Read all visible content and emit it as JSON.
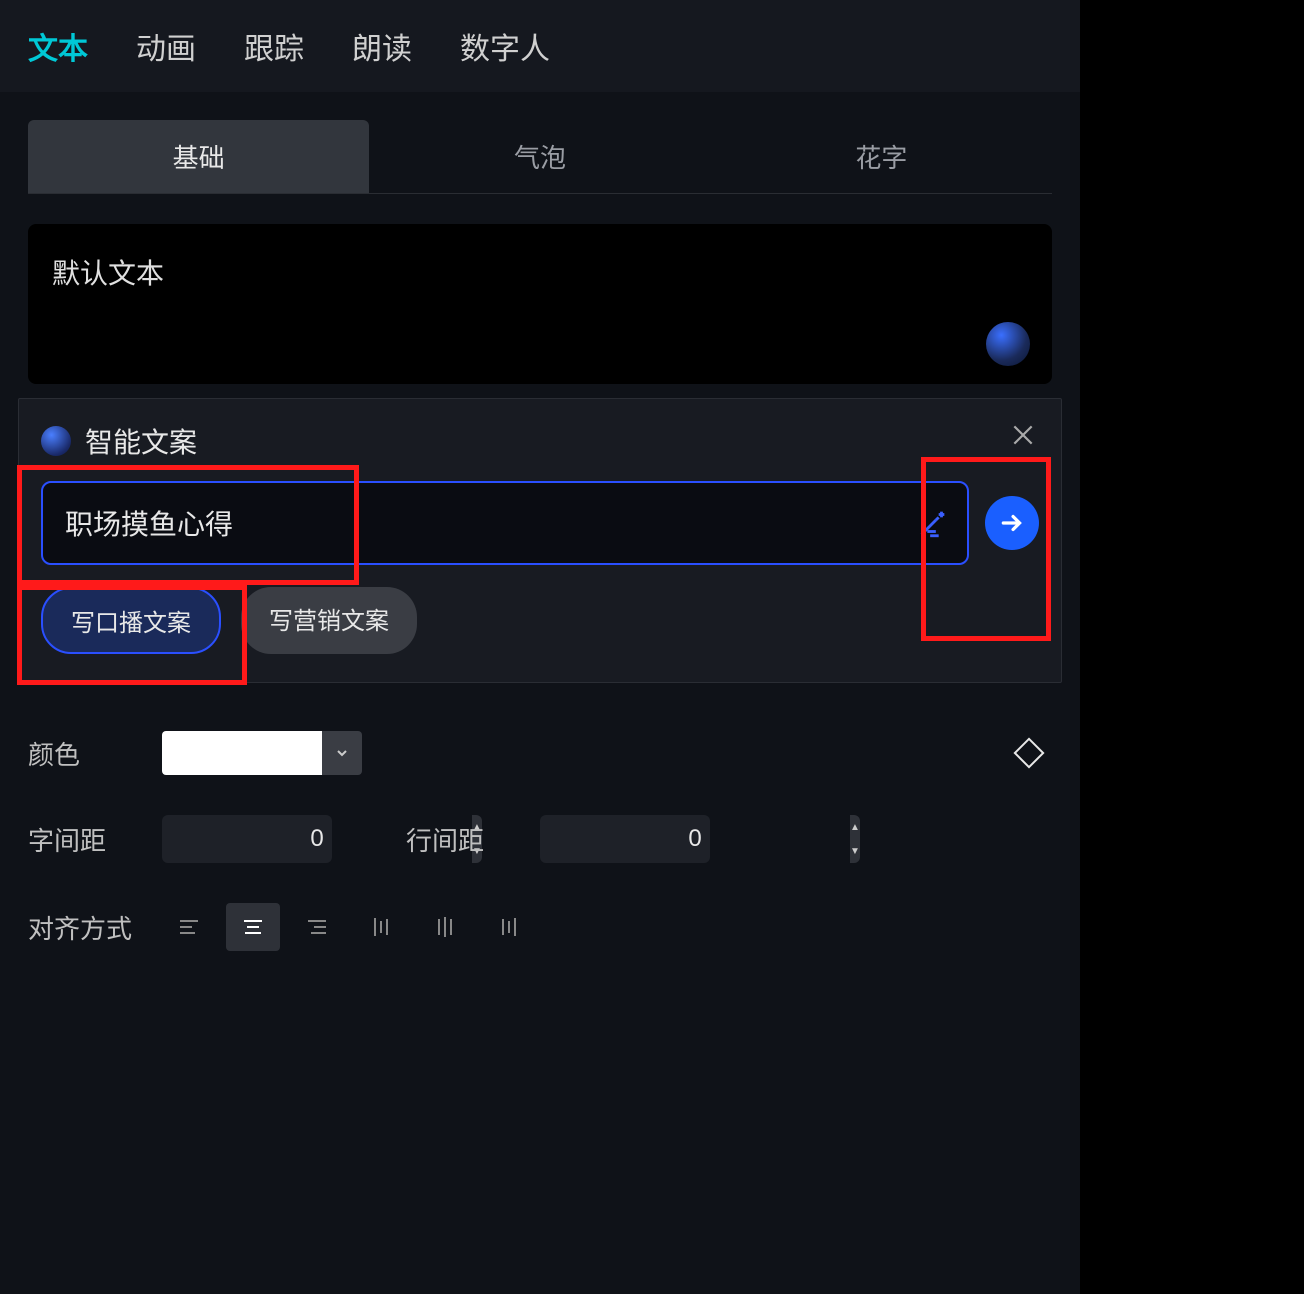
{
  "tabs": {
    "top": [
      "文本",
      "动画",
      "跟踪",
      "朗读",
      "数字人"
    ],
    "top_active_index": 0,
    "sub": [
      "基础",
      "气泡",
      "花字"
    ],
    "sub_active_index": 0
  },
  "text_box": {
    "content": "默认文本"
  },
  "smart_copy": {
    "title": "智能文案",
    "input_value": "职场摸鱼心得",
    "chips": [
      "写口播文案",
      "写营销文案"
    ],
    "chip_active_index": 0
  },
  "properties": {
    "color_label": "颜色",
    "color_value": "#FFFFFF",
    "letter_spacing_label": "字间距",
    "letter_spacing_value": "0",
    "line_spacing_label": "行间距",
    "line_spacing_value": "0",
    "alignment_label": "对齐方式",
    "alignment_active_index": 1
  }
}
